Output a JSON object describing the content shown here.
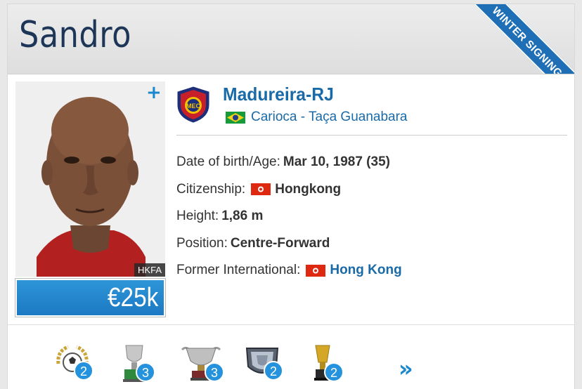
{
  "header": {
    "player_name": "Sandro",
    "ribbon_text": "WINTER SIGNING"
  },
  "photo": {
    "credit": "HKFA",
    "plus_label": "+"
  },
  "market_value": "€25k",
  "club": {
    "name": "Madureira-RJ",
    "league": "Carioca - Taça Guanabara",
    "league_flag": "brazil-flag"
  },
  "info": {
    "dob_label": "Date of birth/Age:",
    "dob_value": "Mar 10, 1987 (35)",
    "citizenship_label": "Citizenship:",
    "citizenship_value": "Hongkong",
    "citizenship_flag": "hongkong-flag",
    "height_label": "Height:",
    "height_value": "1,86 m",
    "position_label": "Position:",
    "position_value": "Centre-Forward",
    "former_label": "Former International:",
    "former_value": "Hong Kong",
    "former_flag": "hongkong-flag"
  },
  "trophies": [
    {
      "icon": "laurel-ball-trophy-icon",
      "count": "2"
    },
    {
      "icon": "cup-trophy-icon",
      "count": "3"
    },
    {
      "icon": "large-cup-trophy-icon",
      "count": "3"
    },
    {
      "icon": "shield-trophy-icon",
      "count": "2"
    },
    {
      "icon": "gold-cup-trophy-icon",
      "count": "2"
    }
  ],
  "more_label": "»",
  "colors": {
    "accent": "#1a6aa8",
    "badge": "#2492dc",
    "ribbon": "#1f6fb6",
    "name": "#1d3557"
  }
}
